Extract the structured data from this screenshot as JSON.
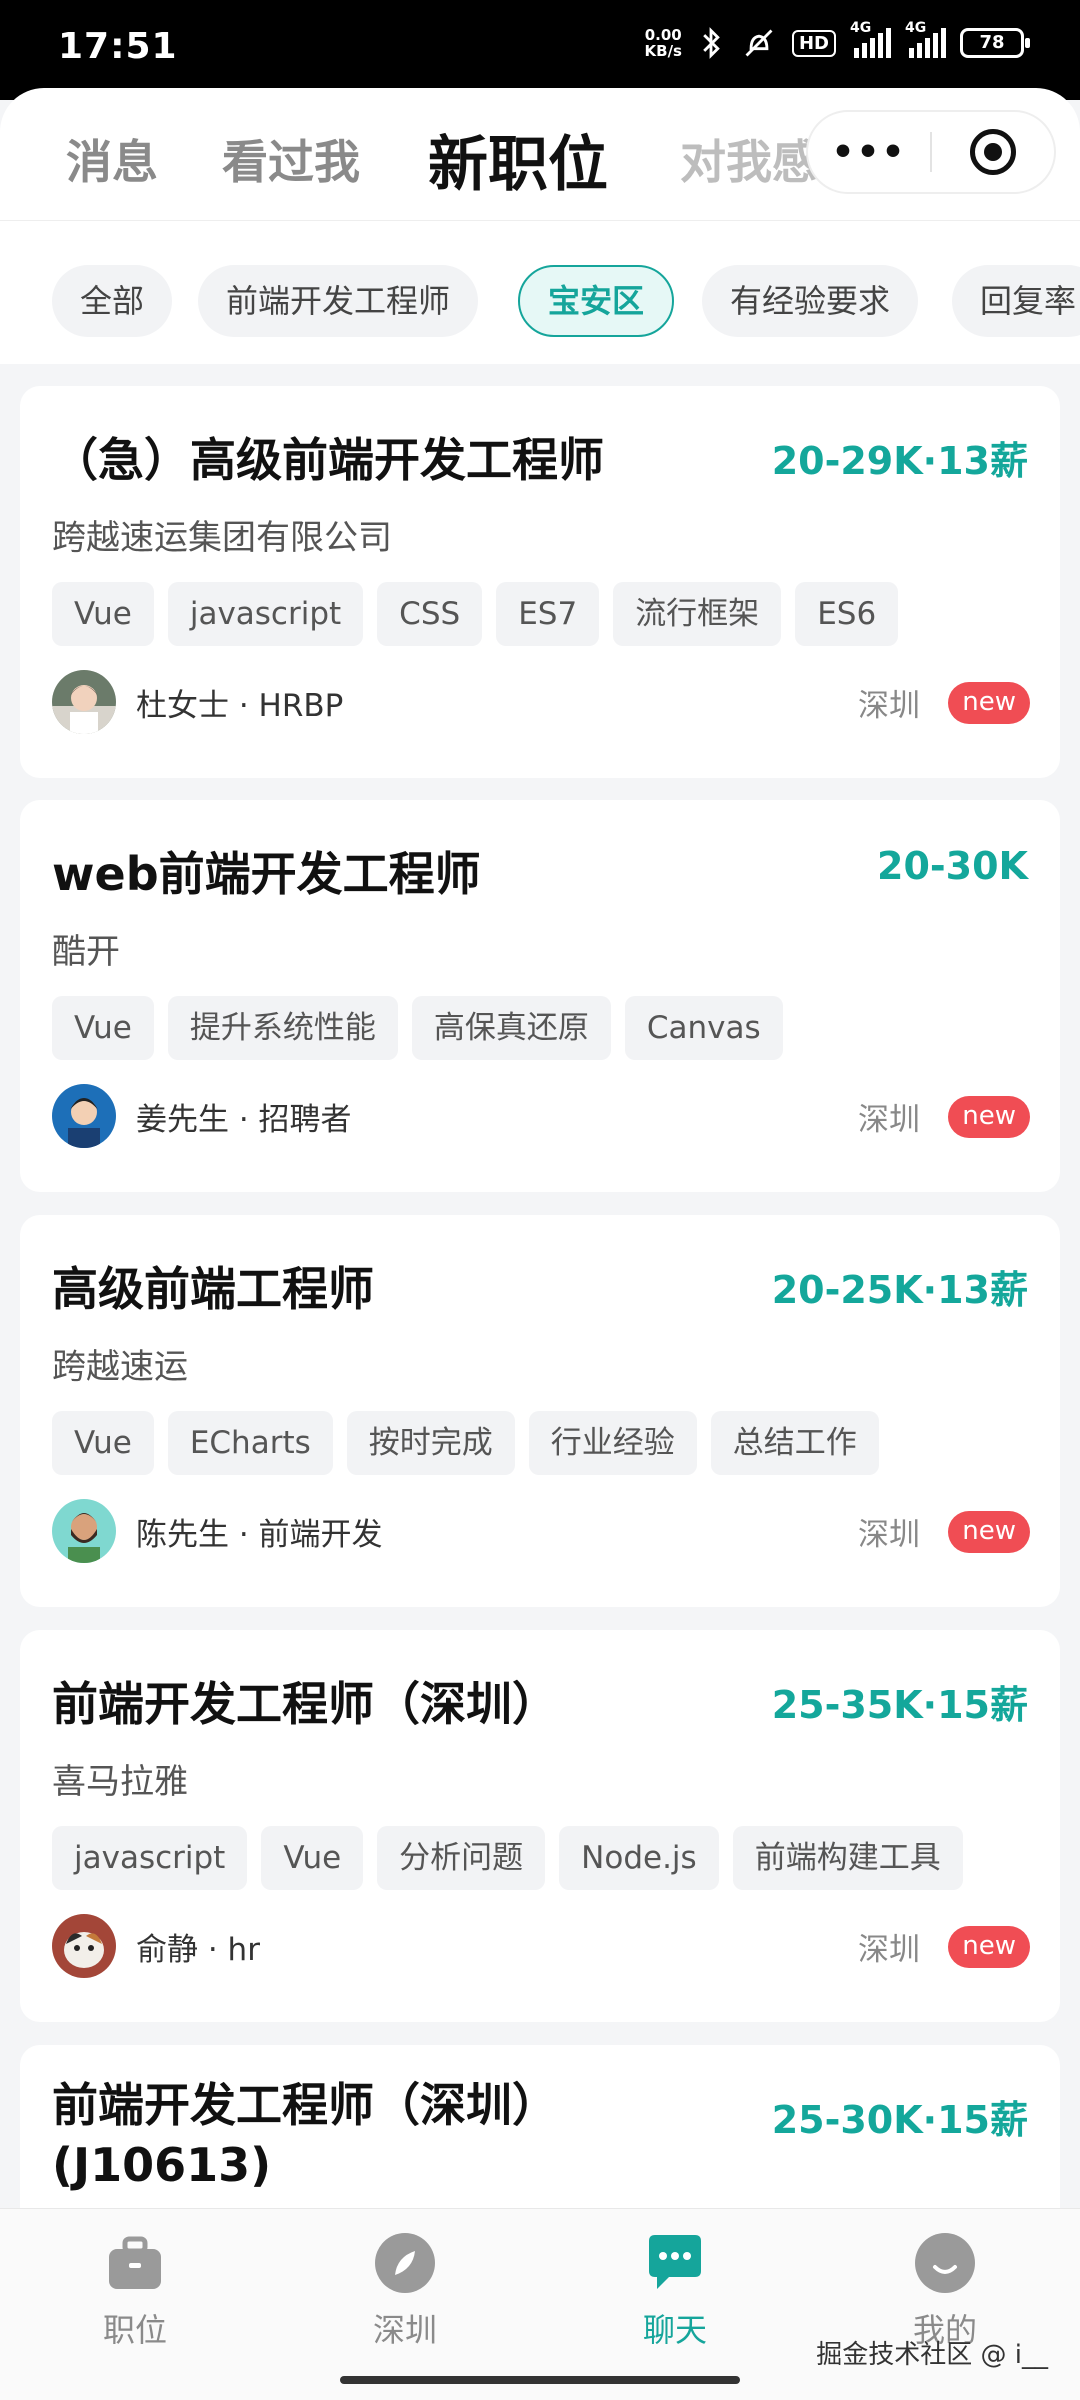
{
  "status_bar": {
    "time": "17:51",
    "net_speed_value": "0.00",
    "net_speed_unit": "KB/s",
    "hd": "HD",
    "signal1": "4G",
    "signal2": "4G",
    "battery": "78"
  },
  "top_tabs": [
    {
      "label": "消息"
    },
    {
      "label": "看过我"
    },
    {
      "label": "新职位"
    },
    {
      "label": "对我感"
    }
  ],
  "active_tab": "新职位",
  "filters": [
    {
      "label": "全部"
    },
    {
      "label": "前端开发工程师"
    },
    {
      "label": "宝安区"
    },
    {
      "label": "有经验要求"
    },
    {
      "label": "回复率"
    }
  ],
  "active_filter": "宝安区",
  "jobs": [
    {
      "title": "（急）高级前端开发工程师",
      "salary": "20-29K·13薪",
      "company": "跨越速运集团有限公司",
      "tags": [
        "Vue",
        "javascript",
        "CSS",
        "ES7",
        "流行框架",
        "ES6"
      ],
      "recruiter": "杜女士 · HRBP",
      "location": "深圳",
      "badge": "new"
    },
    {
      "title": "web前端开发工程师",
      "salary": "20-30K",
      "company": "酷开",
      "tags": [
        "Vue",
        "提升系统性能",
        "高保真还原",
        "Canvas"
      ],
      "recruiter": "姜先生 · 招聘者",
      "location": "深圳",
      "badge": "new"
    },
    {
      "title": "高级前端工程师",
      "salary": "20-25K·13薪",
      "company": "跨越速运",
      "tags": [
        "Vue",
        "ECharts",
        "按时完成",
        "行业经验",
        "总结工作"
      ],
      "recruiter": "陈先生 · 前端开发",
      "location": "深圳",
      "badge": "new"
    },
    {
      "title": "前端开发工程师（深圳）",
      "salary": "25-35K·15薪",
      "company": "喜马拉雅",
      "tags": [
        "javascript",
        "Vue",
        "分析问题",
        "Node.js",
        "前端构建工具"
      ],
      "recruiter": "俞静 · hr",
      "location": "深圳",
      "badge": "new"
    },
    {
      "title": "前端开发工程师（深圳）(J10613)",
      "salary": "25-30K·15薪"
    }
  ],
  "bottom_nav": [
    {
      "label": "职位",
      "icon": "briefcase-icon"
    },
    {
      "label": "深圳",
      "icon": "compass-icon"
    },
    {
      "label": "聊天",
      "icon": "chat-icon"
    },
    {
      "label": "我的",
      "icon": "profile-icon"
    }
  ],
  "active_nav": "聊天",
  "watermark": "掘金技术社区 @ i__",
  "colors": {
    "accent": "#15a59b",
    "badge": "#f04d54"
  }
}
